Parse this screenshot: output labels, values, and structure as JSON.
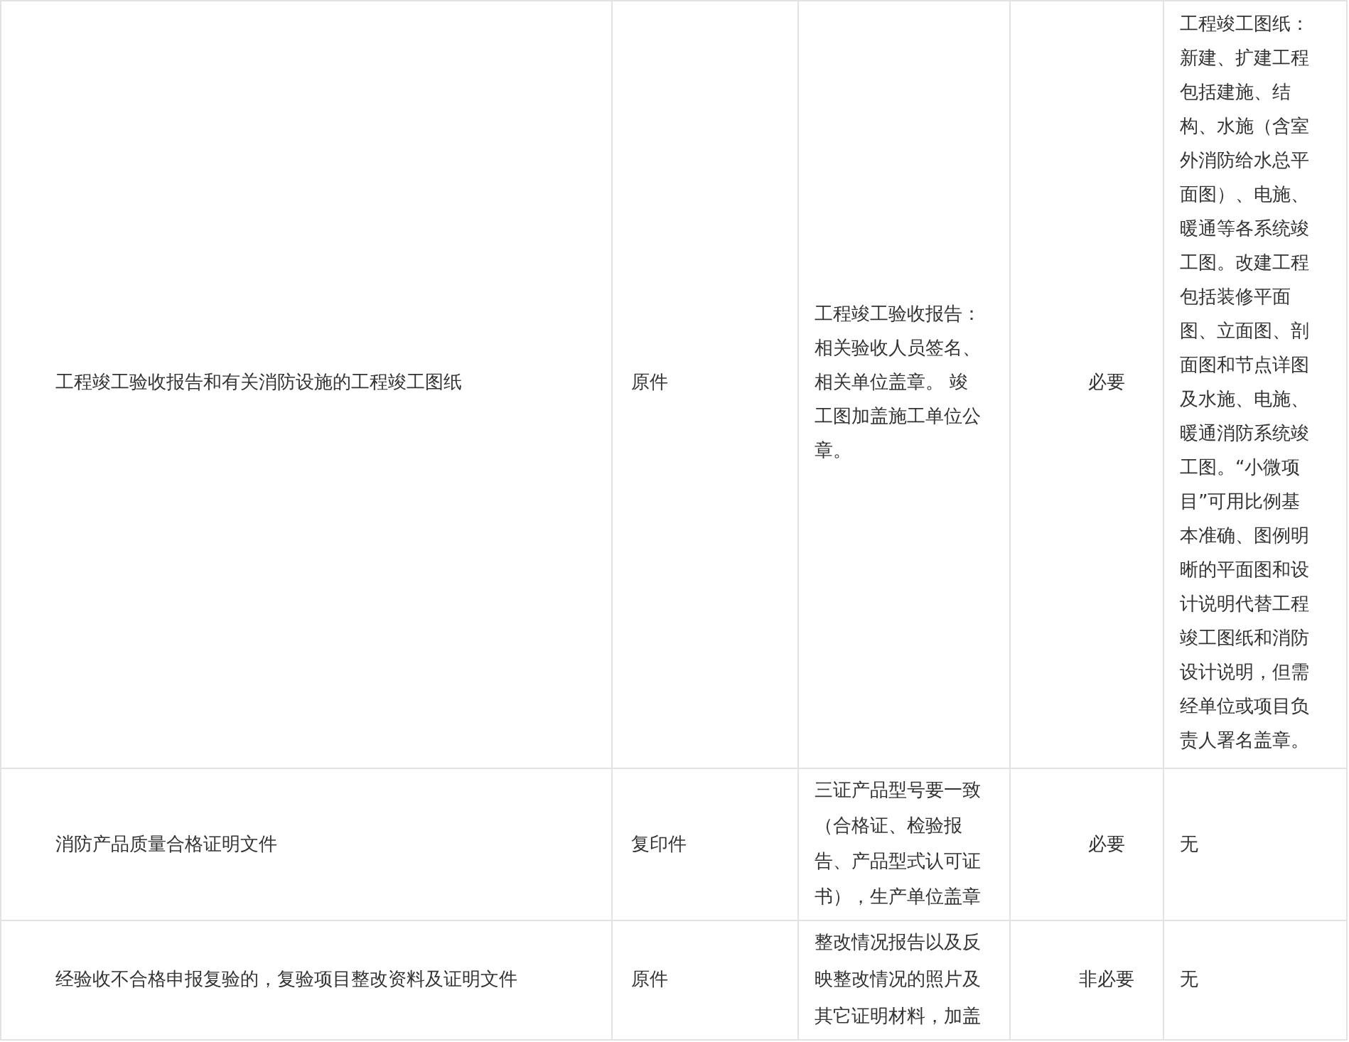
{
  "table": {
    "rows": [
      {
        "cells": [
          "工程竣工验收报告和有关消防设施的工程竣工图纸",
          "原件",
          "工程竣工验收报告：相关验收人员签名、相关单位盖章。 竣工图加盖施工单位公章。",
          "必要",
          "工程竣工图纸：新建、扩建工程包括建施、结构、水施（含室外消防给水总平面图）、电施、暖通等各系统竣工图。改建工程包括装修平面图、立面图、剖面图和节点详图及水施、电施、暖通消防系统竣工图。“小微项目”可用比例基本准确、图例明晰的平面图和设计说明代替工程竣工图纸和消防设计说明，但需经单位或项目负责人署名盖章。"
        ]
      },
      {
        "cells": [
          "消防产品质量合格证明文件",
          "复印件",
          "三证产品型号要一致（合格证、检验报告、产品型式认可证书），生产单位盖章",
          "必要",
          "无"
        ]
      },
      {
        "cells": [
          "经验收不合格申报复验的，复验项目整改资料及证明文件",
          "原件",
          "整改情况报告以及反映整改情况的照片及其它证明材料，加盖",
          "非必要",
          "无"
        ]
      }
    ]
  }
}
